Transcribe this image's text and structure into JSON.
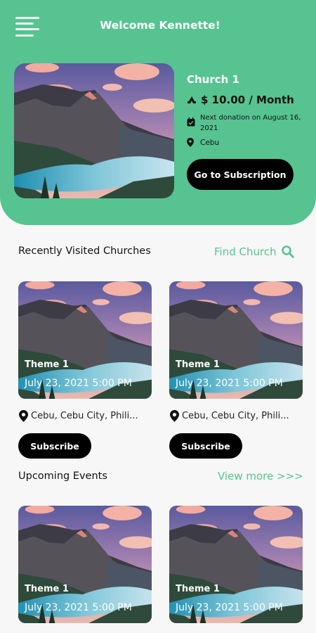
{
  "header": {
    "welcome": "Welcome Kennette!",
    "menu_icon": "hamburger-menu-icon"
  },
  "featured": {
    "name": "Church 1",
    "price": "$ 10.00 / Month",
    "next_donation": "Next donation on August 16, 2021",
    "location": "Cebu",
    "button_label": "Go to Subscription",
    "icons": [
      "hands-icon",
      "calendar-icon",
      "location-pin-icon"
    ]
  },
  "recent": {
    "title": "Recently Visited Churches",
    "link_label": "Find Church",
    "link_icon": "search-icon",
    "cards": [
      {
        "theme": "Theme 1",
        "date": "July 23, 2021 5:00 PM",
        "location": "Cebu, Cebu City, Phili...",
        "button_label": "Subscribe"
      },
      {
        "theme": "Theme 1",
        "date": "July 23, 2021 5:00 PM",
        "location": "Cebu, Cebu City, Phili...",
        "button_label": "Subscribe"
      }
    ]
  },
  "events": {
    "title": "Upcoming Events",
    "link_label": "View more >>>",
    "cards": [
      {
        "theme": "Theme 1",
        "date": "July 23, 2021 5:00 PM"
      },
      {
        "theme": "Theme 1",
        "date": "July 23, 2021 5:00 PM"
      }
    ]
  },
  "colors": {
    "accent": "#56c391",
    "button": "#000000",
    "background": "#f7f7f7"
  }
}
